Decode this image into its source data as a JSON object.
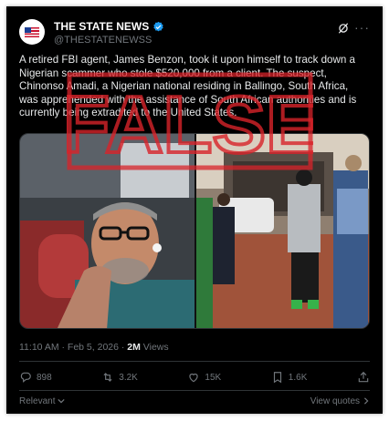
{
  "post": {
    "display_name": "THE STATE NEWS",
    "handle": "@THESTATENEWSS",
    "text": "A retired FBI agent, James Benzon, took it upon himself to track down a Nigerian scammer who stole $520,000 from a client. The suspect, Chinonso Amadi, a Nigerian national residing in Ballingo, South Africa, was apprehended with the assistance of South African authorities and is currently being extradited to the United States.",
    "time": "11:10 AM · Feb 5, 2026 · ",
    "views_count": "2M",
    "views_label": " Views",
    "stamp_text": "FALSE"
  },
  "actions": {
    "replies": "898",
    "reposts": "3.2K",
    "likes": "15K",
    "bookmarks": "1.6K"
  },
  "footer": {
    "relevant": "Relevant",
    "view_quotes": "View quotes"
  },
  "colors": {
    "background": "#000000",
    "text": "#e7e9ea",
    "secondary": "#71767b",
    "verified": "#1d9bf0",
    "stamp": "#d8232a"
  },
  "icons": [
    "grok-icon",
    "more-icon",
    "verified-badge-icon",
    "reply-icon",
    "repost-icon",
    "like-icon",
    "bookmark-icon",
    "share-icon",
    "chevron-down-icon",
    "chevron-right-icon"
  ]
}
